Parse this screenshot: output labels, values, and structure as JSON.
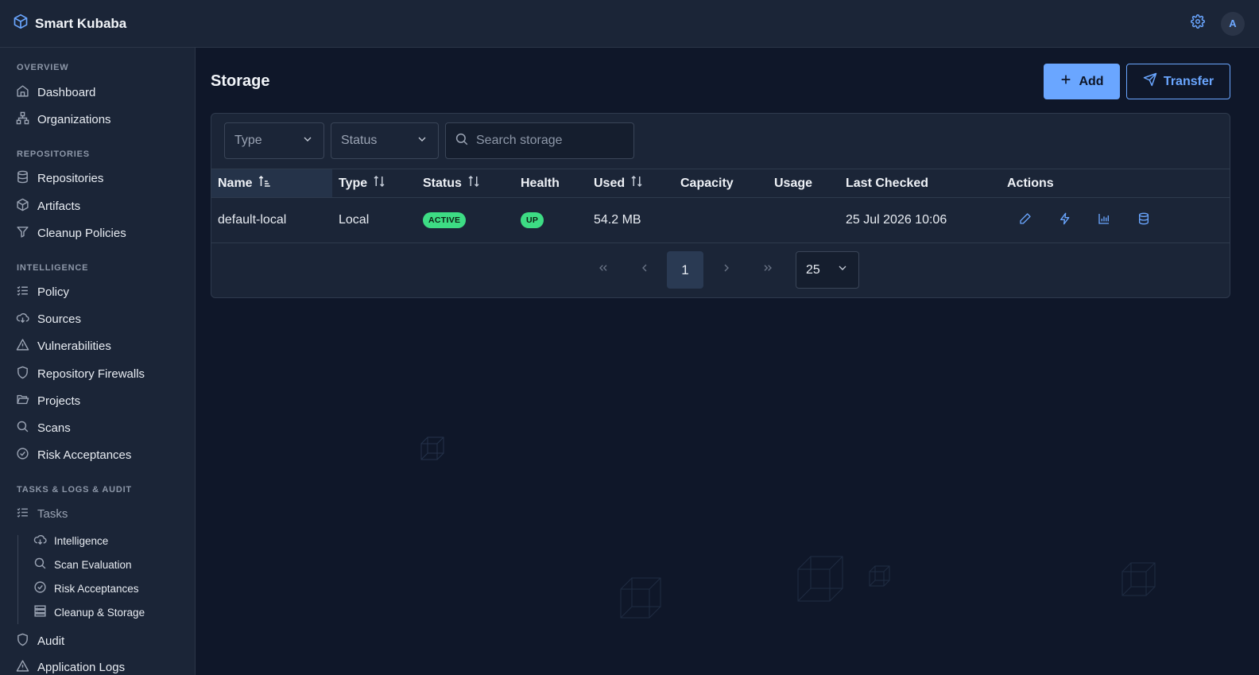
{
  "app": {
    "name": "Smart Kubaba",
    "user_initial": "A"
  },
  "sidebar": {
    "sections": [
      {
        "title": "OVERVIEW"
      },
      {
        "title": "REPOSITORIES"
      },
      {
        "title": "INTELLIGENCE"
      },
      {
        "title": "TASKS & LOGS & AUDIT"
      }
    ],
    "items": [
      {
        "label": "Dashboard",
        "icon": "home-icon"
      },
      {
        "label": "Organizations",
        "icon": "org-chart-icon"
      },
      {
        "label": "Repositories",
        "icon": "database-icon"
      },
      {
        "label": "Artifacts",
        "icon": "box-icon"
      },
      {
        "label": "Cleanup Policies",
        "icon": "filter-icon"
      },
      {
        "label": "Policy",
        "icon": "list-check-icon"
      },
      {
        "label": "Sources",
        "icon": "cloud-download-icon"
      },
      {
        "label": "Vulnerabilities",
        "icon": "warning-icon"
      },
      {
        "label": "Repository Firewalls",
        "icon": "shield-icon"
      },
      {
        "label": "Projects",
        "icon": "folder-open-icon"
      },
      {
        "label": "Scans",
        "icon": "search-icon"
      },
      {
        "label": "Risk Acceptances",
        "icon": "check-circle-icon"
      },
      {
        "label": "Tasks",
        "icon": "list-check-icon"
      },
      {
        "label": "Audit",
        "icon": "shield-icon"
      },
      {
        "label": "Application Logs",
        "icon": "warning-icon"
      }
    ],
    "task_subitems": [
      {
        "label": "Intelligence",
        "icon": "cloud-download-icon"
      },
      {
        "label": "Scan Evaluation",
        "icon": "search-icon"
      },
      {
        "label": "Risk Acceptances",
        "icon": "check-circle-icon"
      },
      {
        "label": "Cleanup & Storage",
        "icon": "server-icon"
      }
    ]
  },
  "page": {
    "title": "Storage",
    "add_label": "Add",
    "transfer_label": "Transfer"
  },
  "filters": {
    "type_placeholder": "Type",
    "status_placeholder": "Status",
    "search_placeholder": "Search storage"
  },
  "table": {
    "columns": [
      "Name",
      "Type",
      "Status",
      "Health",
      "Used",
      "Capacity",
      "Usage",
      "Last Checked",
      "Actions"
    ],
    "rows": [
      {
        "name": "default-local",
        "type": "Local",
        "status": "ACTIVE",
        "health": "UP",
        "used": "54.2 MB",
        "capacity": "",
        "usage": "",
        "last_checked": "25 Jul 2026 10:06"
      }
    ]
  },
  "pagination": {
    "current_page": "1",
    "page_size": "25"
  },
  "colors": {
    "accent": "#6aa6ff",
    "success": "#3ddc84",
    "background": "#0f1729",
    "surface": "#1b2537"
  }
}
